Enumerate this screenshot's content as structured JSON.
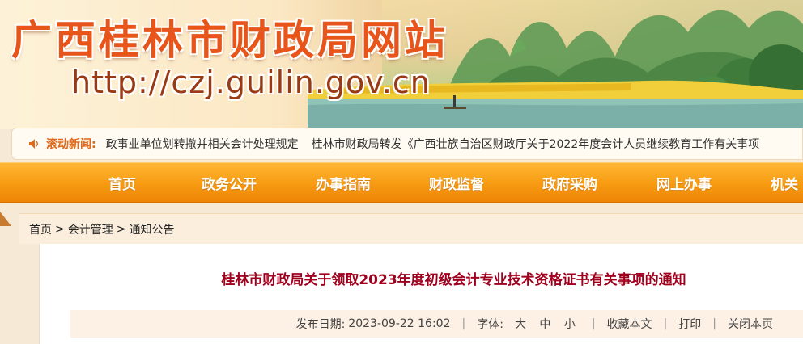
{
  "site": {
    "title": "广西桂林市财政局网站",
    "url": "http://czj.guilin.gov.cn"
  },
  "news": {
    "label": "滚动新闻:",
    "items": [
      "政事业单位划转撤并相关会计处理规定",
      "桂林市财政局转发《广西壮族自治区财政厅关于2022年度会计人员继续教育工作有关事项"
    ]
  },
  "nav": {
    "items": [
      "首页",
      "政务公开",
      "办事指南",
      "财政监督",
      "政府采购",
      "网上办事",
      "机关"
    ]
  },
  "breadcrumb": {
    "items": [
      "首页",
      "会计管理",
      "通知公告"
    ],
    "separator": ">"
  },
  "article": {
    "title": "桂林市财政局关于领取2023年度初级会计专业技术资格证书有关事项的通知",
    "meta": {
      "date_label": "发布日期:",
      "date_value": "2023-09-22 16:02",
      "font_label": "字体:",
      "font_sizes": [
        "大",
        "中",
        "小"
      ],
      "favorite": "收藏本文",
      "print": "打印",
      "close": "关闭本页"
    }
  },
  "colors": {
    "nav_orange": "#f79a12",
    "title_red": "#a0001e",
    "news_label": "#e06a1c",
    "banner_title": "#e8551a"
  }
}
